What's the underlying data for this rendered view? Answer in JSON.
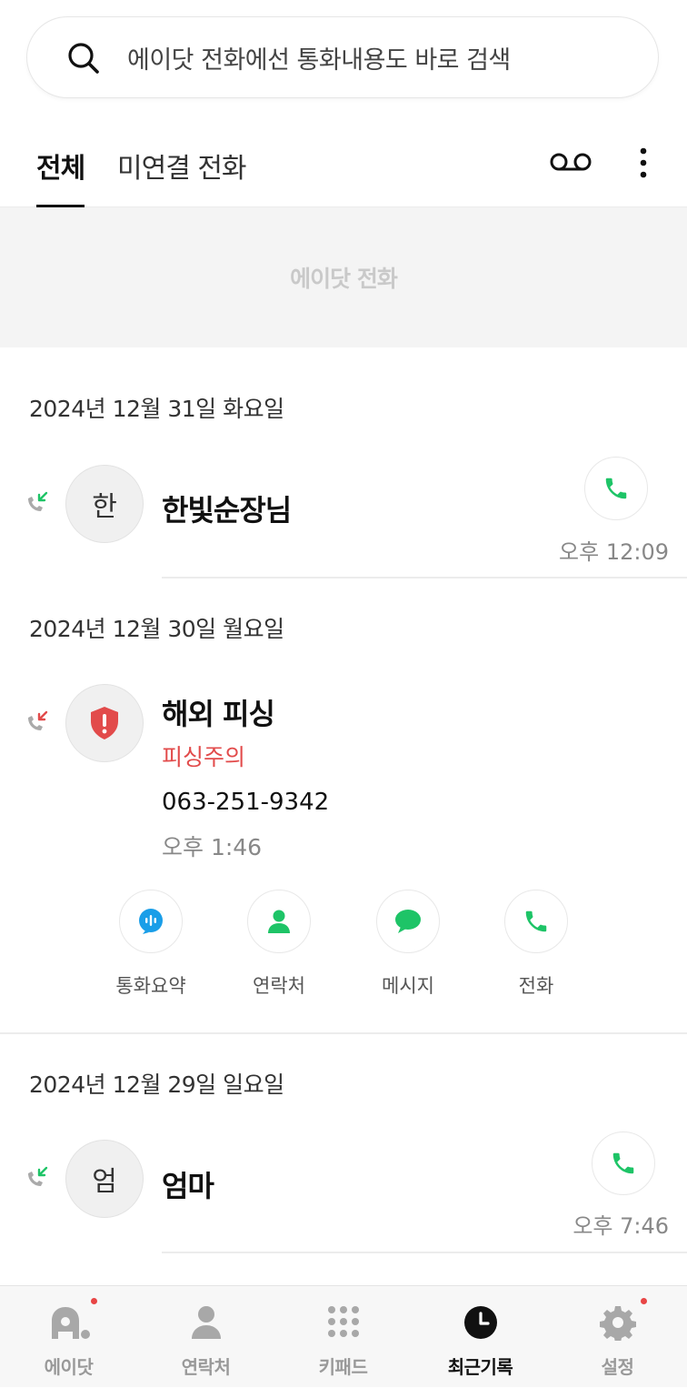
{
  "search": {
    "placeholder": "에이닷 전화에선 통화내용도 바로 검색"
  },
  "tabs": [
    {
      "label": "전체"
    },
    {
      "label": "미연결 전화"
    }
  ],
  "banner": {
    "text": "에이닷 전화"
  },
  "groups": [
    {
      "date": "2024년 12월 31일 화요일",
      "entry": {
        "avatar": "한",
        "name": "한빛순장님",
        "time": "오후 12:09"
      }
    },
    {
      "date": "2024년 12월 30일 월요일",
      "entry": {
        "name": "해외 피싱",
        "warning": "피싱주의",
        "number": "063-251-9342",
        "time": "오후 1:46",
        "actions": [
          {
            "label": "통화요약"
          },
          {
            "label": "연락처"
          },
          {
            "label": "메시지"
          },
          {
            "label": "전화"
          }
        ]
      }
    },
    {
      "date": "2024년 12월 29일 일요일",
      "entry": {
        "avatar": "엄",
        "name": "엄마",
        "time": "오후 7:46"
      }
    }
  ],
  "bottom_nav": [
    {
      "label": "에이닷",
      "icon": "adot-icon"
    },
    {
      "label": "연락처",
      "icon": "person-icon"
    },
    {
      "label": "키패드",
      "icon": "keypad-icon"
    },
    {
      "label": "최근기록",
      "icon": "clock-icon"
    },
    {
      "label": "설정",
      "icon": "gear-icon"
    }
  ],
  "colors": {
    "call_green": "#1ec467",
    "phishing_red": "#e24b4b",
    "summary_blue": "#1a9ee8",
    "notify_dot": "#e84545"
  }
}
